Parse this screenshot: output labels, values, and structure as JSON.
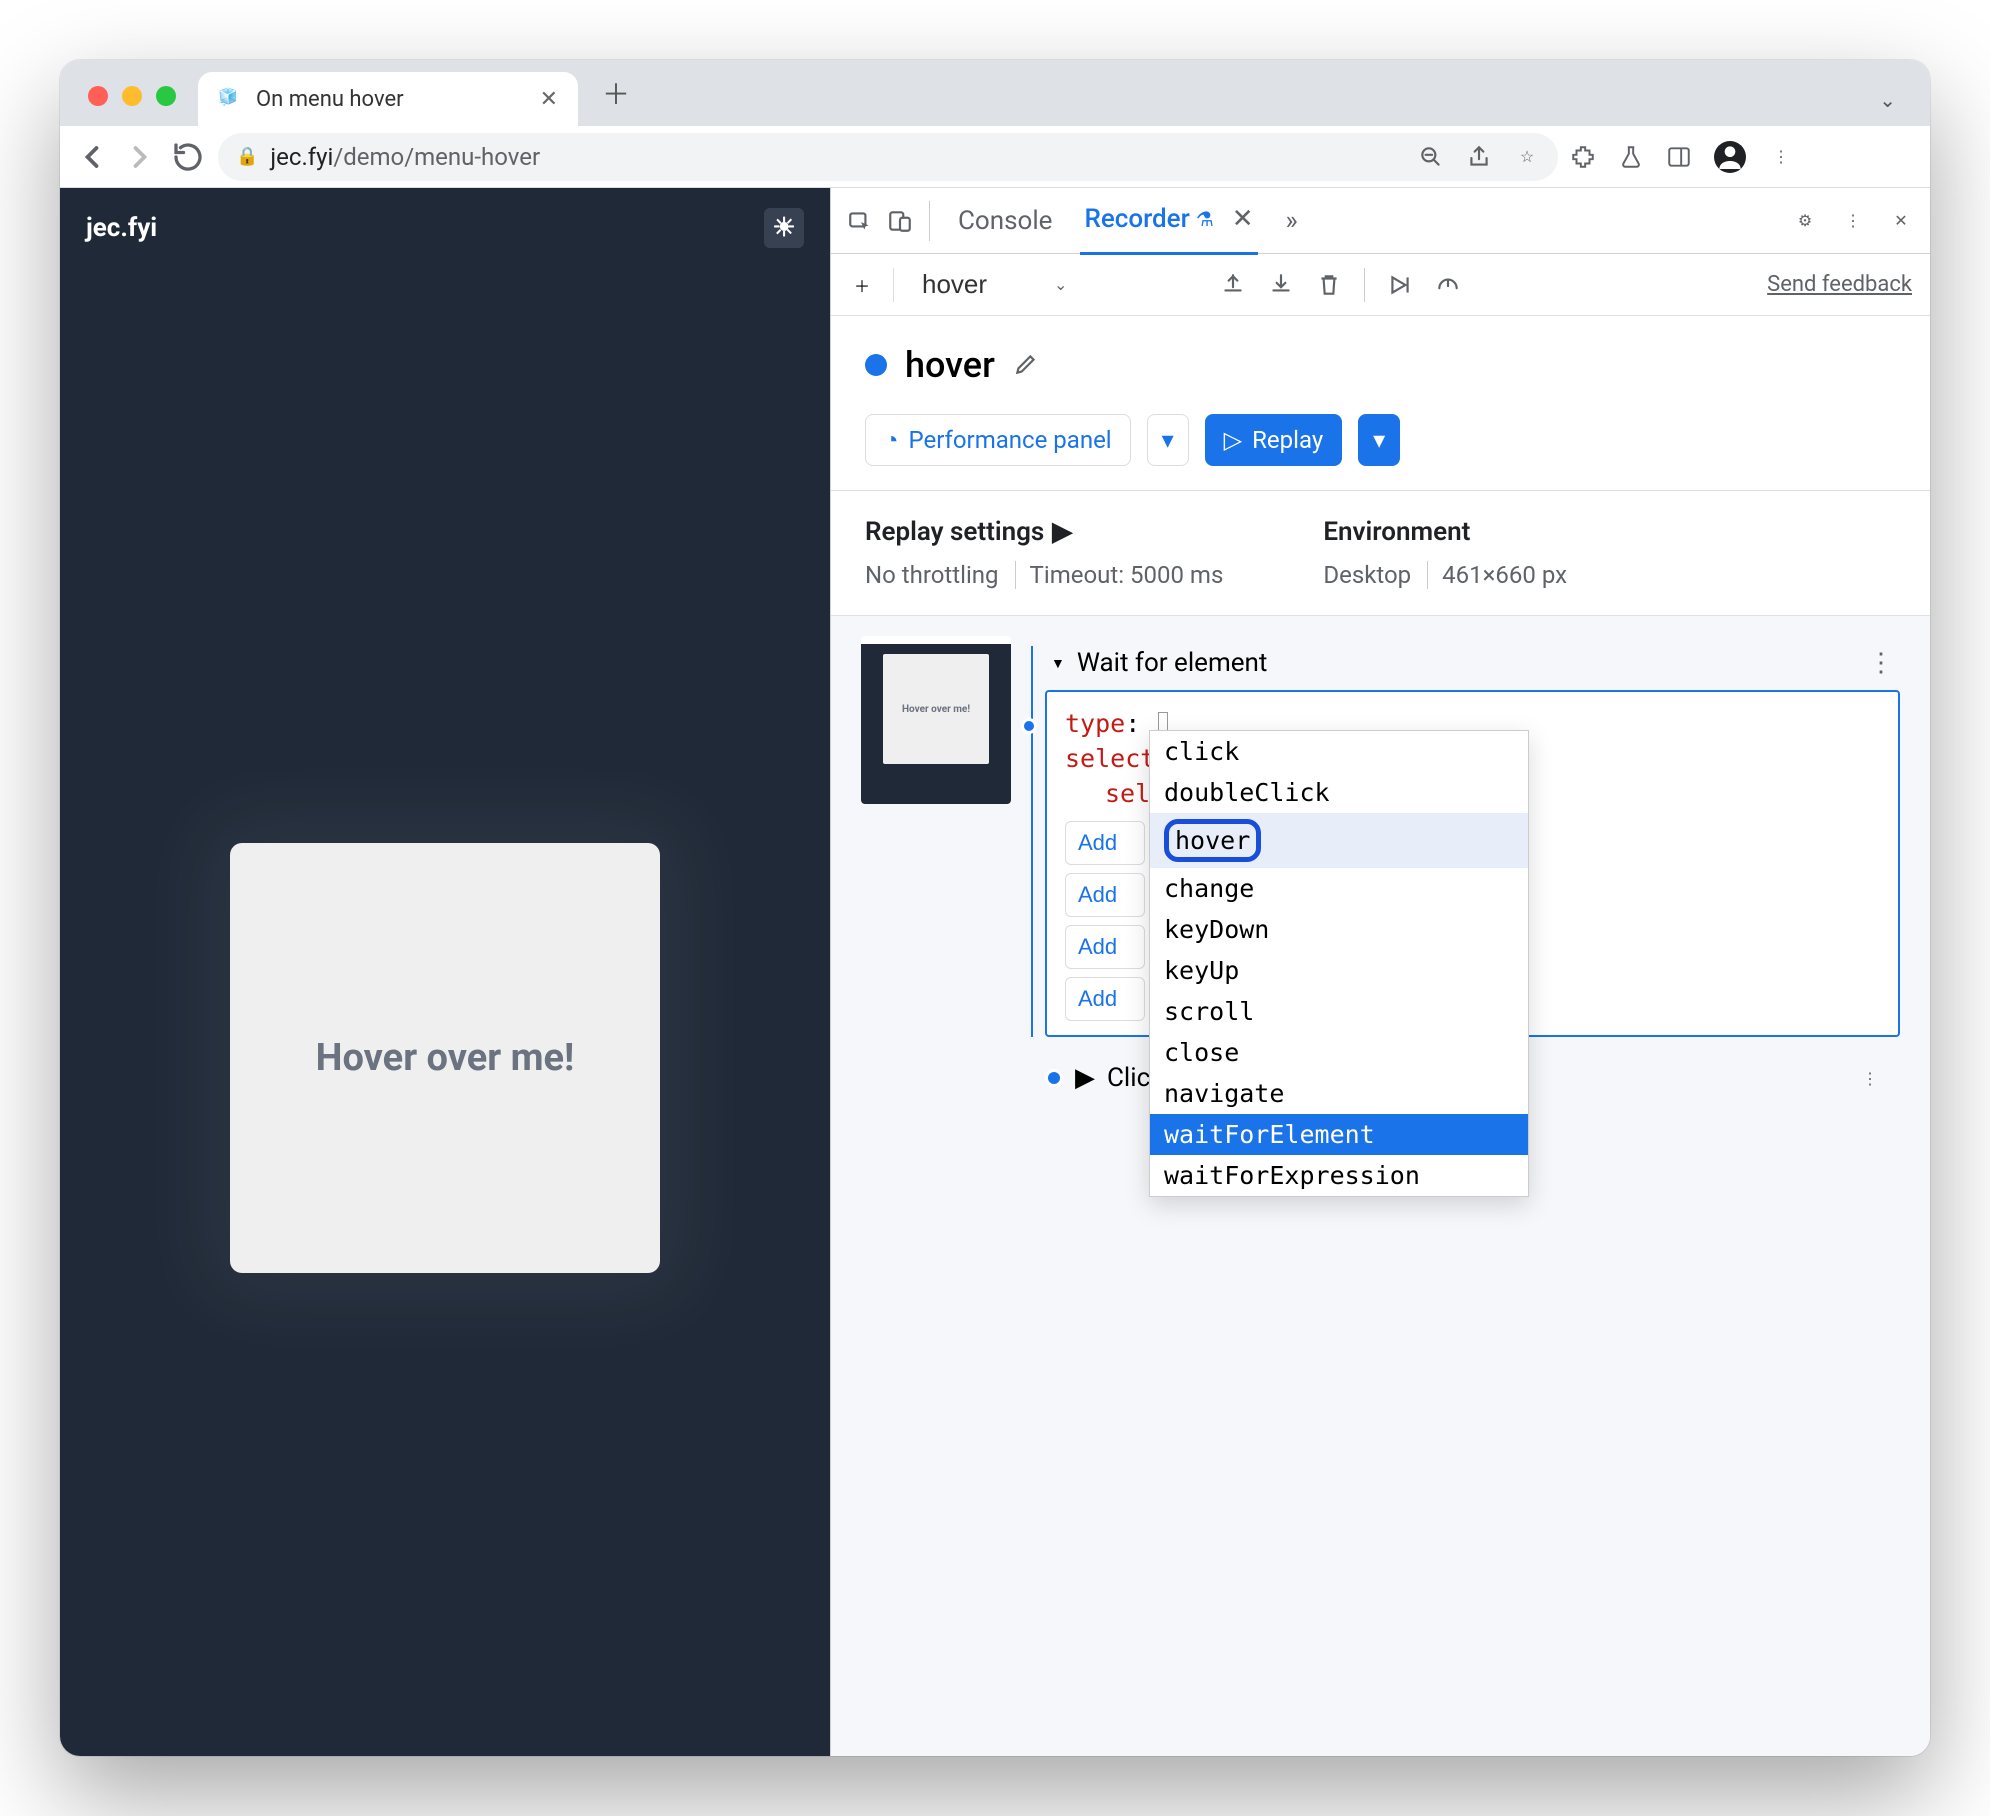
{
  "browser": {
    "tab_title": "On menu hover",
    "url_host": "jec.fyi",
    "url_path": "/demo/menu-hover"
  },
  "page": {
    "brand": "jec.fyi",
    "card_text": "Hover over me!"
  },
  "devtools": {
    "tabs": {
      "console": "Console",
      "recorder": "Recorder",
      "more": "»"
    },
    "recording_name": "hover",
    "feedback": "Send feedback",
    "title": "hover",
    "perf_btn": "Performance panel",
    "replay_btn": "Replay",
    "settings": {
      "replay_heading": "Replay settings",
      "no_throttle": "No throttling",
      "timeout": "Timeout: 5000 ms",
      "env_heading": "Environment",
      "device": "Desktop",
      "viewport": "461×660 px"
    },
    "step1": {
      "title": "Wait for element",
      "code": {
        "type_key": "type",
        "selectors_key": "selectors",
        "sel_key": "sel"
      },
      "add_btns": [
        "Add",
        "Add",
        "Add",
        "Add"
      ]
    },
    "dropdown": {
      "options": [
        "click",
        "doubleClick",
        "hover",
        "change",
        "keyDown",
        "keyUp",
        "scroll",
        "close",
        "navigate",
        "waitForElement",
        "waitForExpression"
      ],
      "highlighted": "hover",
      "selected": "waitForElement"
    },
    "step2": {
      "title": "Click"
    }
  }
}
